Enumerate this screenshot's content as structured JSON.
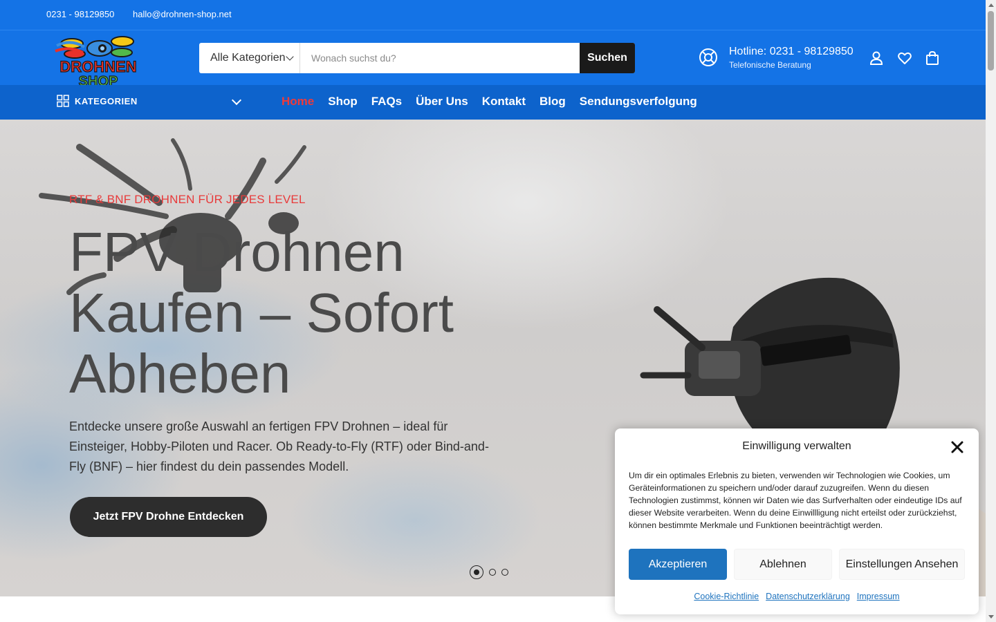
{
  "topbar": {
    "phone": "0231 - 98129850",
    "email": "hallo@drohnen-shop.net"
  },
  "header": {
    "logo": {
      "line1": "DROHNEN",
      "line2": "SHOP",
      "colors": [
        "#e8312a",
        "#f6c816",
        "#3a8ede",
        "#52b84b"
      ]
    },
    "search": {
      "category": "Alle Kategorien",
      "placeholder": "Wonach suchst du?",
      "button": "Suchen"
    },
    "hotline": {
      "title": "Hotline: 0231 - 98129850",
      "subtitle": "Telefonische Beratung"
    },
    "icons": [
      "lifebuoy-icon",
      "user-icon",
      "heart-icon",
      "shopping-bag-icon"
    ]
  },
  "nav": {
    "categories_label": "KATEGORIEN",
    "items": [
      {
        "label": "Home",
        "active": true
      },
      {
        "label": "Shop"
      },
      {
        "label": "FAQs"
      },
      {
        "label": "Über Uns"
      },
      {
        "label": "Kontakt"
      },
      {
        "label": "Blog"
      },
      {
        "label": "Sendungsverfolgung"
      }
    ]
  },
  "hero": {
    "eyebrow": "RTF & BNF DROHNEN FÜR JEDES LEVEL",
    "title_lines": [
      "FPV Drohnen",
      "Kaufen – Sofort",
      "Abheben"
    ],
    "description": "Entdecke unsere große Auswahl an fertigen FPV Drohnen – ideal für Einsteiger, Hobby-Piloten und Racer. Ob Ready-to-Fly (RTF) oder Bind-and-Fly (BNF) – hier findest du dein passendes Modell.",
    "cta": "Jetzt FPV Drohne Entdecken",
    "slides": {
      "count": 3,
      "active": 1
    }
  },
  "cookie": {
    "title": "Einwilligung verwalten",
    "text": "Um dir ein optimales Erlebnis zu bieten, verwenden wir Technologien wie Cookies, um Geräteinformationen zu speichern und/oder darauf zuzugreifen. Wenn du diesen Technologien zustimmst, können wir Daten wie das Surfverhalten oder eindeutige IDs auf dieser Website verarbeiten. Wenn du deine Einwillligung nicht erteilst oder zurückziehst, können bestimmte Merkmale und Funktionen beeinträchtigt werden.",
    "accept": "Akzeptieren",
    "deny": "Ablehnen",
    "preferences": "Einstellungen Ansehen",
    "links": [
      "Cookie-Richtlinie",
      "Datenschutzerklärung",
      "Impressum"
    ]
  },
  "colors": {
    "brand_blue": "#1473e6",
    "nav_blue": "#0d63cc",
    "accent_red": "#e83a3a",
    "button_dark": "#2d2d2d",
    "cookie_accept": "#1e73be"
  }
}
